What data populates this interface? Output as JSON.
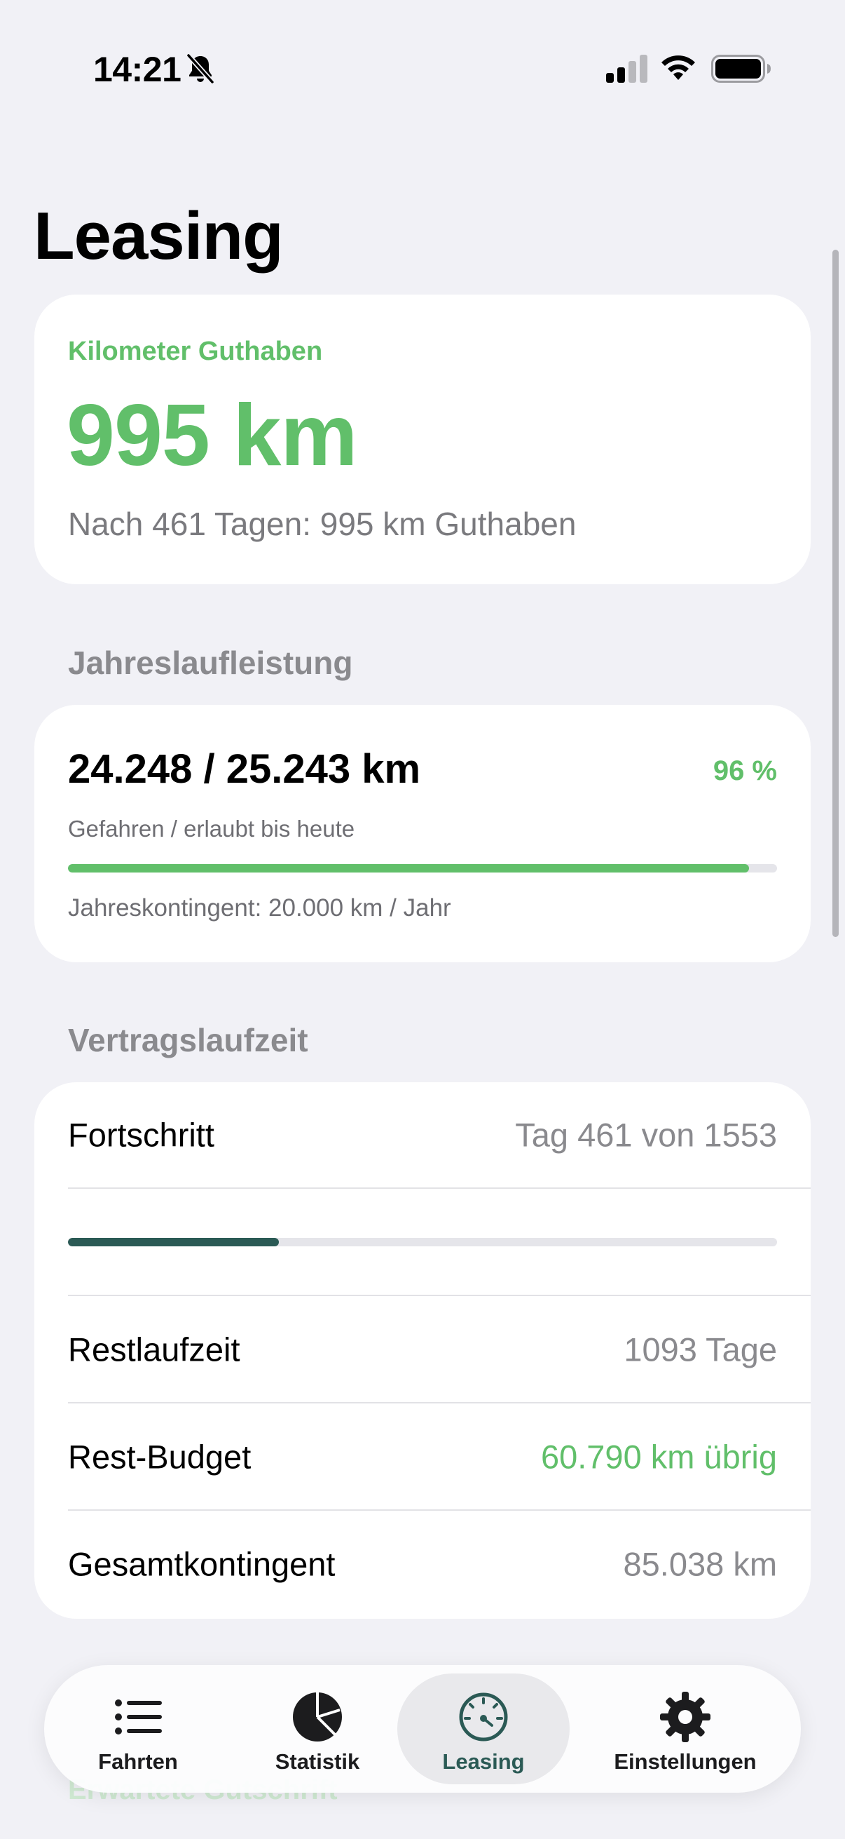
{
  "status_bar": {
    "time": "14:21",
    "icons": [
      "bell-slash-icon",
      "cellular-signal-icon",
      "wifi-icon",
      "battery-icon"
    ]
  },
  "page": {
    "title": "Leasing"
  },
  "credit_card": {
    "label": "Kilometer Guthaben",
    "value": "995 km",
    "subtitle": "Nach 461 Tagen: 995 km Guthaben"
  },
  "annual": {
    "section_title": "Jahreslaufleistung",
    "value": "24.248 / 25.243 km",
    "percent": "96 %",
    "progress_fraction": 0.96,
    "caption": "Gefahren / erlaubt bis heute",
    "quota": "Jahreskontingent: 20.000 km / Jahr"
  },
  "contract": {
    "section_title": "Vertragslaufzeit",
    "progress_label": "Fortschritt",
    "progress_value": "Tag 461 von 1553",
    "progress_fraction": 0.297,
    "remaining_label": "Restlaufzeit",
    "remaining_value": "1093 Tage",
    "budget_label": "Rest-Budget",
    "budget_value": "60.790 km übrig",
    "total_label": "Gesamtkontingent",
    "total_value": "85.038 km"
  },
  "below_fold": {
    "expected_credit": "Erwartete Gutschrift"
  },
  "tab_bar": {
    "tabs": [
      {
        "label": "Fahrten",
        "icon": "list-icon",
        "active": false
      },
      {
        "label": "Statistik",
        "icon": "pie-chart-icon",
        "active": false
      },
      {
        "label": "Leasing",
        "icon": "speedometer-icon",
        "active": true
      },
      {
        "label": "Einstellungen",
        "icon": "gear-icon",
        "active": false
      }
    ]
  },
  "colors": {
    "accent_green": "#61bf6a",
    "accent_dark_teal": "#2b5a55",
    "background": "#f1f1f6",
    "secondary_text": "#8a8a8e"
  }
}
